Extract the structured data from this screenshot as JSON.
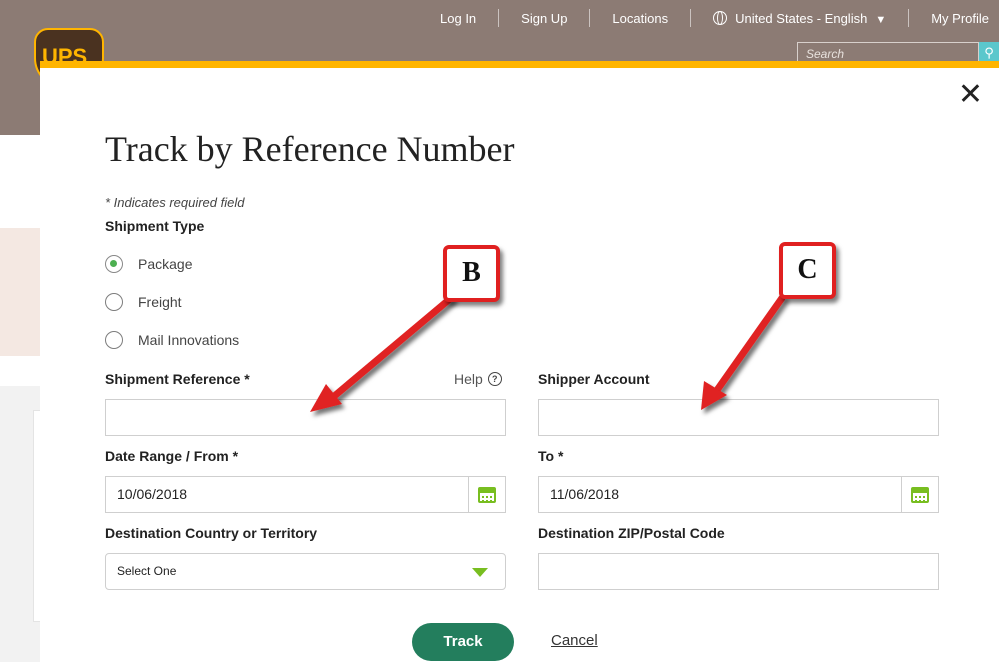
{
  "top_nav": {
    "login": "Log In",
    "signup": "Sign Up",
    "locations": "Locations",
    "language": "United States - English",
    "profile": "My Profile"
  },
  "search": {
    "placeholder": "Search"
  },
  "logo": {
    "text": "UPS"
  },
  "modal": {
    "title": "Track by Reference Number",
    "required_note": "* Indicates required field",
    "shipment_type_label": "Shipment Type",
    "shipment_types": [
      {
        "label": "Package",
        "selected": true
      },
      {
        "label": "Freight",
        "selected": false
      },
      {
        "label": "Mail Innovations",
        "selected": false
      }
    ],
    "shipment_reference_label": "Shipment Reference *",
    "help_label": "Help",
    "shipper_account_label": "Shipper Account",
    "date_from_label": "Date Range / From *",
    "date_from_value": "10/06/2018",
    "date_to_label": "To *",
    "date_to_value": "11/06/2018",
    "destination_country_label": "Destination Country or Territory",
    "destination_country_value": "Select One",
    "destination_zip_label": "Destination ZIP/Postal Code",
    "track_button": "Track",
    "cancel_link": "Cancel"
  },
  "annotations": {
    "b": "B",
    "c": "C"
  },
  "colors": {
    "header_bg": "#8c7b74",
    "accent_gold": "#ffb500",
    "green": "#78be20",
    "track_green": "#237e5d",
    "annotation_red": "#e02020"
  }
}
